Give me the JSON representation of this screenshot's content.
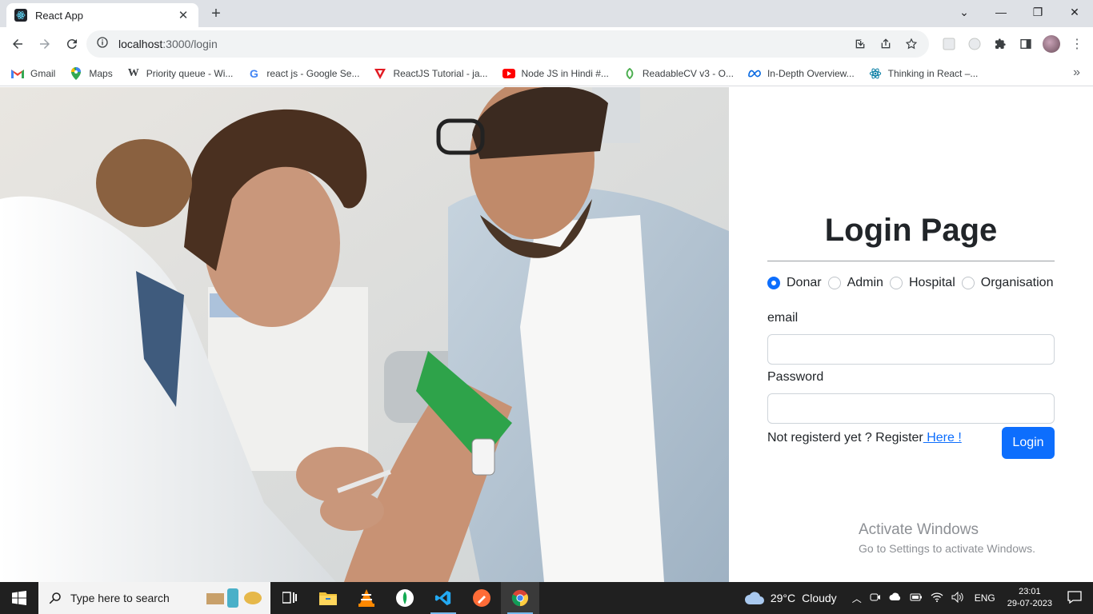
{
  "browser": {
    "tab_title": "React App",
    "url_host": "localhost",
    "url_rest": ":3000/login",
    "bookmarks": [
      {
        "label": "Gmail",
        "icon": "gmail-icon"
      },
      {
        "label": "Maps",
        "icon": "maps-icon"
      },
      {
        "label": "Priority queue - Wi...",
        "icon": "wikipedia-icon"
      },
      {
        "label": "react js - Google Se...",
        "icon": "google-icon"
      },
      {
        "label": "ReactJS Tutorial - ja...",
        "icon": "javatpoint-icon"
      },
      {
        "label": "Node JS in Hindi #...",
        "icon": "youtube-icon"
      },
      {
        "label": "ReadableCV v3 - O...",
        "icon": "readablecv-icon"
      },
      {
        "label": "In-Depth Overview...",
        "icon": "meta-icon"
      },
      {
        "label": "Thinking in React –...",
        "icon": "react-icon"
      }
    ],
    "bookmarks_more": "»"
  },
  "login": {
    "title": "Login Page",
    "roles": [
      "Donar",
      "Admin",
      "Hospital",
      "Organisation"
    ],
    "selected_role": "Donar",
    "email_label": "email",
    "email_value": "",
    "password_label": "Password",
    "password_value": "",
    "register_text": "Not registerd yet ? Register",
    "register_link": " Here !",
    "login_button": "Login"
  },
  "watermark": {
    "line1": "Activate Windows",
    "line2": "Go to Settings to activate Windows."
  },
  "taskbar": {
    "search_placeholder": "Type here to search",
    "weather_temp": "29°C",
    "weather_desc": "Cloudy",
    "language": "ENG",
    "time": "23:01",
    "date": "29-07-2023"
  },
  "colors": {
    "primary": "#0d6efd",
    "taskbar": "#202020",
    "chrome_tabstrip": "#dee1e6"
  }
}
